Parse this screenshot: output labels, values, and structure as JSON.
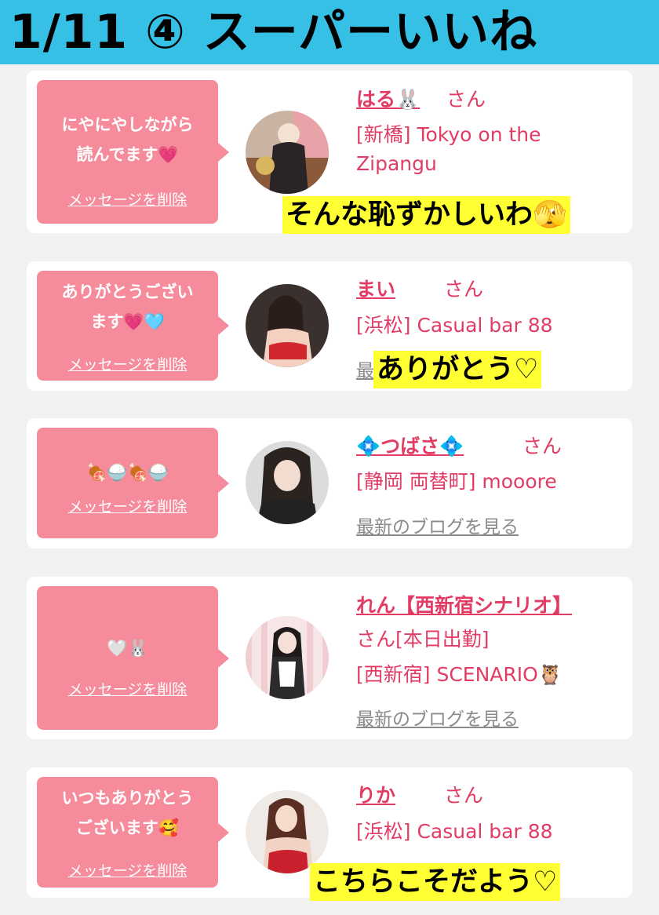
{
  "header": {
    "title": "1/11 ④ スーパーいいね"
  },
  "items": [
    {
      "message_lines": [
        "にやにやしながら",
        "読んでます💗"
      ],
      "delete_label": "メッセージを削除",
      "name": "はる🐰",
      "suffix": "さん",
      "shop_lines": [
        "[新橋] Tokyo on the",
        "Zipangu"
      ],
      "blog_label": "",
      "caption": "そんな恥ずかしいわ🫣"
    },
    {
      "message_lines": [
        "ありがとうござい",
        "ます💗🩵"
      ],
      "delete_label": "メッセージを削除",
      "name": "まい",
      "suffix": "さん",
      "shop_lines": [
        "[浜松] Casual bar 88"
      ],
      "blog_label": "最",
      "caption": "ありがとう♡"
    },
    {
      "message_lines": [
        "🍖🍚🍖🍚"
      ],
      "delete_label": "メッセージを削除",
      "name": "💠つばさ💠",
      "suffix": "さん",
      "shop_lines": [
        "[静岡 両替町] mooore"
      ],
      "blog_label": "最新のブログを見る",
      "caption": ""
    },
    {
      "message_lines": [
        "🤍🐰"
      ],
      "delete_label": "メッセージを削除",
      "name": "れん【西新宿シナリオ】",
      "suffix": "さん[本日出勤]",
      "shop_lines": [
        "[西新宿] SCENARIO🦉"
      ],
      "blog_label": "最新のブログを見る",
      "caption": ""
    },
    {
      "message_lines": [
        "いつもありがとう",
        "ございます🥰"
      ],
      "delete_label": "メッセージを削除",
      "name": "りか",
      "suffix": "さん",
      "shop_lines": [
        "[浜松] Casual bar 88"
      ],
      "blog_label": "",
      "caption": "こちらこそだよう♡"
    }
  ]
}
